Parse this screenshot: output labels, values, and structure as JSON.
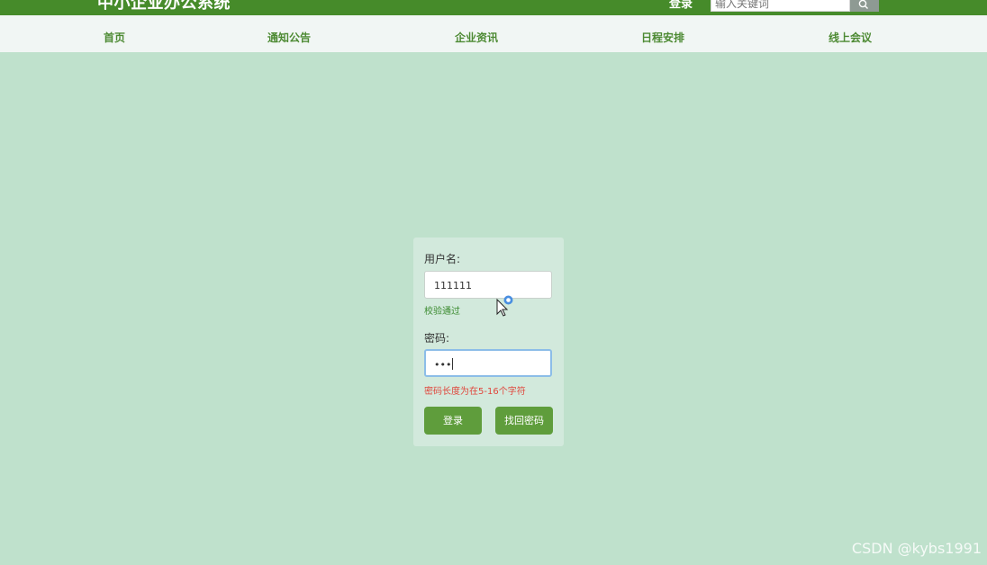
{
  "header": {
    "brand": "中小企业办公系统",
    "login_label": "登录",
    "search_placeholder": "输入关键词"
  },
  "nav": {
    "items": [
      {
        "label": "首页"
      },
      {
        "label": "通知公告"
      },
      {
        "label": "企业资讯"
      },
      {
        "label": "日程安排"
      },
      {
        "label": "线上会议"
      }
    ]
  },
  "login_form": {
    "username_label": "用户名:",
    "username_value": "111111",
    "username_hint": "校验通过",
    "password_label": "密码:",
    "password_value": "•••",
    "password_hint": "密码长度为在5-16个字符",
    "login_button": "登录",
    "recover_button": "找回密码"
  },
  "watermark": "CSDN @kybs1991",
  "colors": {
    "header_bg": "#468b2a",
    "nav_bg": "#f1f6f4",
    "page_bg": "#bfe1cc",
    "card_bg": "#d2e9dc",
    "button_bg": "#5f9d3c",
    "ok_text": "#3a8a2e",
    "error_text": "#e0463c"
  }
}
